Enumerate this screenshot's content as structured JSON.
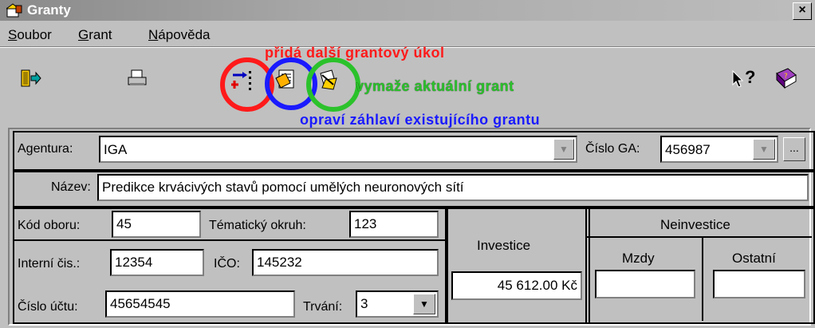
{
  "window": {
    "title": "Granty",
    "close_glyph": "×"
  },
  "menu": {
    "items": [
      {
        "accel": "S",
        "rest": "oubor"
      },
      {
        "accel": "G",
        "rest": "rant"
      },
      {
        "accel": "N",
        "rest": "ápověda"
      }
    ]
  },
  "annotations": {
    "add_task": "přidá další grantový úkol",
    "delete_grant": "vymaže aktuální grant",
    "edit_header": "opraví záhlaví existujícího grantu"
  },
  "toolbar": {
    "icons": [
      "exit-icon",
      "print-icon",
      "add-task-icon",
      "edit-header-icon",
      "delete-grant-icon",
      "whats-this-icon",
      "help-book-icon"
    ],
    "help_glyph": "?"
  },
  "form": {
    "agentura_label": "Agentura:",
    "agentura_value": "IGA",
    "cislo_ga_label": "Číslo GA:",
    "cislo_ga_value": "456987",
    "ellipsis": "...",
    "nazev_label": "Název:",
    "nazev_value": "Predikce krvácivých stavů pomocí umělých neuronových sítí",
    "kod_oboru_label": "Kód oboru:",
    "kod_oboru_value": "45",
    "tematicky_label": "Tématický okruh:",
    "tematicky_value": "123",
    "interni_label": "Interní čis.:",
    "interni_value": "12354",
    "ico_label": "IČO:",
    "ico_value": "145232",
    "cislo_uctu_label": "Číslo účtu:",
    "cislo_uctu_value": "45654545",
    "trvani_label": "Trvání:",
    "trvani_value": "3",
    "investice_label": "Investice",
    "investice_value": "45 612.00 Kč",
    "neinvestice_label": "Neinvestice",
    "mzdy_label": "Mzdy",
    "mzdy_value": "",
    "ostatni_label": "Ostatní",
    "ostatni_value": "",
    "dropdown_glyph": "▼"
  }
}
